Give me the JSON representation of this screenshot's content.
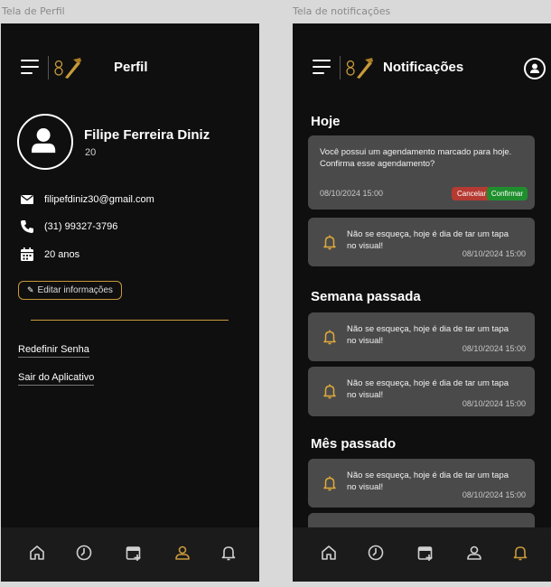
{
  "frames": {
    "left_label": "Tela de Perfil",
    "right_label": "Tela de notificações"
  },
  "profile": {
    "title": "Perfil",
    "name": "Filipe Ferreira Diniz",
    "age_number": "20",
    "email": "filipefdiniz30@gmail.com",
    "phone": "(31) 99327-3796",
    "age_text": "20 anos",
    "edit_button": "Editar informações",
    "links": [
      "Redefinir Senha",
      "Sair do Aplicativo"
    ]
  },
  "notifications": {
    "title": "Notificações",
    "sections": [
      "Hoje",
      "Semana passada",
      "Mês passado"
    ],
    "appointment": {
      "text": "Você possui um agendamento marcado para hoje. Confirma esse agendamento?",
      "date": "08/10/2024 15:00",
      "cancel_label": "Cancelar",
      "confirm_label": "Confirmar"
    },
    "reminder": {
      "text": "Não se esqueça, hoje é dia de tar um tapa no visual!",
      "date": "08/10/2024 15:00"
    }
  },
  "nav": {
    "items": [
      "home-icon",
      "clock-icon",
      "calendar-add-icon",
      "user-icon",
      "bell-icon"
    ],
    "colors": {
      "inactive": "#d0d0d0",
      "active": "#c89a3a"
    }
  },
  "colors": {
    "accent": "#c89a3a",
    "cancel": "#b53a32",
    "confirm": "#1f8f2e",
    "card": "#4a4a4a",
    "background": "#0f0f0f"
  }
}
